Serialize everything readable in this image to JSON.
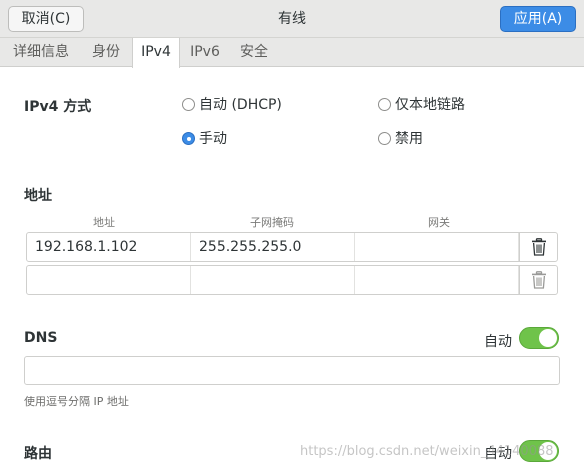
{
  "header": {
    "cancel_label": "取消(C)",
    "title": "有线",
    "apply_label": "应用(A)"
  },
  "tabs": [
    {
      "label": "详细信息"
    },
    {
      "label": "身份"
    },
    {
      "label": "IPv4"
    },
    {
      "label": "IPv6"
    },
    {
      "label": "安全"
    }
  ],
  "ipv4": {
    "method_label": "IPv4 方式",
    "options": [
      {
        "label": "自动 (DHCP)",
        "checked": false
      },
      {
        "label": "仅本地链路",
        "checked": false
      },
      {
        "label": "手动",
        "checked": true
      },
      {
        "label": "禁用",
        "checked": false
      }
    ]
  },
  "addresses": {
    "section_label": "地址",
    "columns": [
      "地址",
      "子网掩码",
      "网关"
    ],
    "rows": [
      {
        "address": "192.168.1.102",
        "netmask": "255.255.255.0",
        "gateway": ""
      },
      {
        "address": "",
        "netmask": "",
        "gateway": ""
      }
    ]
  },
  "dns": {
    "label": "DNS",
    "auto_label": "自动",
    "auto_on": true,
    "value": "",
    "hint": "使用逗号分隔 IP 地址"
  },
  "routes": {
    "label": "路由",
    "auto_label": "自动",
    "auto_on": true
  },
  "watermark": "https://blog.csdn.net/weixin_44140088",
  "colors": {
    "accent": "#3c8ce6",
    "switch_on": "#6fc34a"
  }
}
